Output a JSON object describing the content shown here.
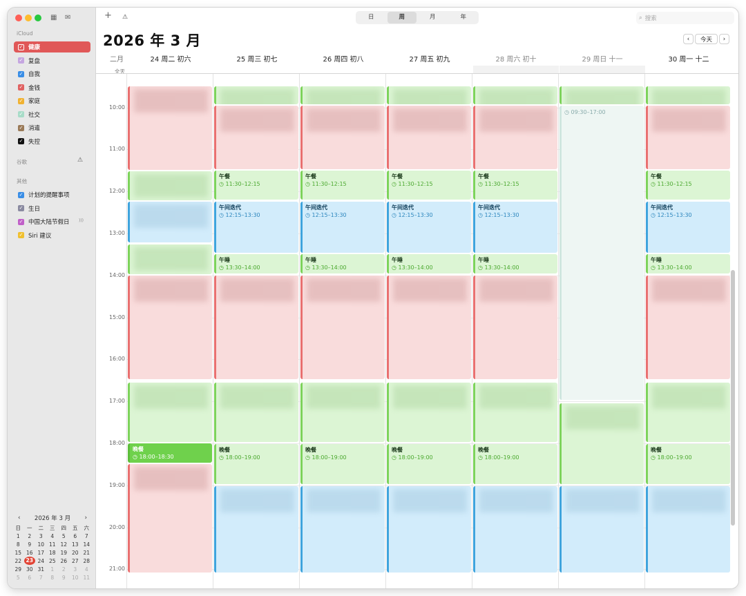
{
  "sidebar": {
    "icloud_label": "iCloud",
    "icloud_items": [
      {
        "label": "健康",
        "color": "#e05858",
        "selected": true
      },
      {
        "label": "复盘",
        "color": "#c5a6e0"
      },
      {
        "label": "自我",
        "color": "#3a8ee6"
      },
      {
        "label": "金钱",
        "color": "#e06262"
      },
      {
        "label": "家庭",
        "color": "#f0b232"
      },
      {
        "label": "社交",
        "color": "#a8dcc8"
      },
      {
        "label": "消遣",
        "color": "#9a7a58"
      },
      {
        "label": "失控",
        "color": "#111111"
      }
    ],
    "google_label": "谷歌",
    "other_label": "其他",
    "other_items": [
      {
        "label": "计划的提醒事项",
        "color": "#3a8ee6"
      },
      {
        "label": "生日",
        "color": "#8a8aa0"
      },
      {
        "label": "中国大陆节假日",
        "color": "#c060c8"
      },
      {
        "label": "Siri 建议",
        "color": "#f0c030"
      }
    ]
  },
  "mini_calendar": {
    "title": "2026 年 3 月",
    "weekdays": [
      "日",
      "一",
      "二",
      "三",
      "四",
      "五",
      "六"
    ],
    "weeks": [
      [
        "1",
        "2",
        "3",
        "4",
        "5",
        "6",
        "7"
      ],
      [
        "8",
        "9",
        "10",
        "11",
        "12",
        "13",
        "14"
      ],
      [
        "15",
        "16",
        "17",
        "18",
        "19",
        "20",
        "21"
      ],
      [
        "22",
        "23",
        "24",
        "25",
        "26",
        "27",
        "28"
      ],
      [
        "29",
        "30",
        "31",
        "1",
        "2",
        "3",
        "4"
      ],
      [
        "5",
        "6",
        "7",
        "8",
        "9",
        "10",
        "11"
      ]
    ],
    "today": "23"
  },
  "toolbar": {
    "add": "+",
    "views": [
      "日",
      "周",
      "月",
      "年"
    ],
    "active_view": "周",
    "search_placeholder": "搜索"
  },
  "header": {
    "title": "2026 年 3 月",
    "today_button": "今天",
    "month_label": "二月",
    "all_day_label": "全天",
    "days": [
      "24 周二  初六",
      "25 周三 初七",
      "26 周四  初八",
      "27 周五  初九",
      "28 周六  初十",
      "29 周日  十一",
      "30 周一  十二"
    ]
  },
  "time_labels": [
    "10:00",
    "11:00",
    "12:00",
    "13:00",
    "14:00",
    "15:00",
    "16:00",
    "17:00",
    "18:00",
    "19:00",
    "20:00",
    "21:00"
  ],
  "events": [
    {
      "col": 0,
      "start": 9.5,
      "end": 11.52,
      "kind": "r"
    },
    {
      "col": 0,
      "start": 11.52,
      "end": 12.25,
      "kind": "g"
    },
    {
      "col": 0,
      "start": 12.25,
      "end": 13.25,
      "kind": "b"
    },
    {
      "col": 0,
      "start": 13.27,
      "end": 14.0,
      "kind": "g"
    },
    {
      "col": 0,
      "start": 14.0,
      "end": 16.5,
      "kind": "r"
    },
    {
      "col": 0,
      "start": 16.55,
      "end": 18.0,
      "kind": "g"
    },
    {
      "col": 0,
      "start": 18.0,
      "end": 18.5,
      "kind": "gs",
      "title": "晚餐",
      "time": "18:00–18:30"
    },
    {
      "col": 0,
      "start": 18.5,
      "end": 21.1,
      "kind": "r"
    },
    {
      "col": 1,
      "start": 9.5,
      "end": 9.95,
      "kind": "g"
    },
    {
      "col": 1,
      "start": 9.95,
      "end": 11.5,
      "kind": "r"
    },
    {
      "col": 1,
      "start": 11.5,
      "end": 12.22,
      "kind": "g",
      "title": "午餐",
      "time": "11:30–12:15"
    },
    {
      "col": 1,
      "start": 12.25,
      "end": 13.5,
      "kind": "b",
      "title": "午间迭代",
      "time": "12:15–13:30"
    },
    {
      "col": 1,
      "start": 13.5,
      "end": 13.98,
      "kind": "g",
      "title": "午睡",
      "time": "13:30–14:00"
    },
    {
      "col": 1,
      "start": 14.0,
      "end": 16.5,
      "kind": "r"
    },
    {
      "col": 1,
      "start": 16.55,
      "end": 18.0,
      "kind": "g"
    },
    {
      "col": 1,
      "start": 18.02,
      "end": 19.0,
      "kind": "g",
      "title": "晚餐",
      "time": "18:00–19:00"
    },
    {
      "col": 1,
      "start": 19.02,
      "end": 21.1,
      "kind": "b"
    },
    {
      "col": 2,
      "start": 9.5,
      "end": 9.95,
      "kind": "g"
    },
    {
      "col": 2,
      "start": 9.95,
      "end": 11.5,
      "kind": "r"
    },
    {
      "col": 2,
      "start": 11.5,
      "end": 12.22,
      "kind": "g",
      "title": "午餐",
      "time": "11:30–12:15"
    },
    {
      "col": 2,
      "start": 12.25,
      "end": 13.5,
      "kind": "b",
      "title": "午间迭代",
      "time": "12:15–13:30"
    },
    {
      "col": 2,
      "start": 13.5,
      "end": 13.98,
      "kind": "g",
      "title": "午睡",
      "time": "13:30–14:00"
    },
    {
      "col": 2,
      "start": 14.0,
      "end": 16.5,
      "kind": "r"
    },
    {
      "col": 2,
      "start": 16.55,
      "end": 18.0,
      "kind": "g"
    },
    {
      "col": 2,
      "start": 18.02,
      "end": 19.0,
      "kind": "g",
      "title": "晚餐",
      "time": "18:00–19:00"
    },
    {
      "col": 2,
      "start": 19.02,
      "end": 21.1,
      "kind": "b"
    },
    {
      "col": 3,
      "start": 9.5,
      "end": 9.95,
      "kind": "g"
    },
    {
      "col": 3,
      "start": 9.95,
      "end": 11.5,
      "kind": "r"
    },
    {
      "col": 3,
      "start": 11.5,
      "end": 12.22,
      "kind": "g",
      "title": "午餐",
      "time": "11:30–12:15"
    },
    {
      "col": 3,
      "start": 12.25,
      "end": 13.5,
      "kind": "b",
      "title": "午间迭代",
      "time": "12:15–13:30"
    },
    {
      "col": 3,
      "start": 13.5,
      "end": 13.98,
      "kind": "g",
      "title": "午睡",
      "time": "13:30–14:00"
    },
    {
      "col": 3,
      "start": 14.0,
      "end": 16.5,
      "kind": "r"
    },
    {
      "col": 3,
      "start": 16.55,
      "end": 18.0,
      "kind": "g"
    },
    {
      "col": 3,
      "start": 18.02,
      "end": 19.0,
      "kind": "g",
      "title": "晚餐",
      "time": "18:00–19:00"
    },
    {
      "col": 3,
      "start": 19.02,
      "end": 21.1,
      "kind": "b"
    },
    {
      "col": 4,
      "start": 9.5,
      "end": 9.95,
      "kind": "g"
    },
    {
      "col": 4,
      "start": 9.95,
      "end": 11.5,
      "kind": "r"
    },
    {
      "col": 4,
      "start": 11.5,
      "end": 12.22,
      "kind": "g",
      "title": "午餐",
      "time": "11:30–12:15"
    },
    {
      "col": 4,
      "start": 12.25,
      "end": 13.5,
      "kind": "b",
      "title": "午间迭代",
      "time": "12:15–13:30"
    },
    {
      "col": 4,
      "start": 13.5,
      "end": 13.98,
      "kind": "g",
      "title": "午睡",
      "time": "13:30–14:00"
    },
    {
      "col": 4,
      "start": 14.0,
      "end": 16.5,
      "kind": "r"
    },
    {
      "col": 4,
      "start": 16.55,
      "end": 18.0,
      "kind": "g"
    },
    {
      "col": 4,
      "start": 18.02,
      "end": 19.0,
      "kind": "g",
      "title": "晚餐",
      "time": "18:00–19:00"
    },
    {
      "col": 4,
      "start": 19.02,
      "end": 21.1,
      "kind": "b"
    },
    {
      "col": 5,
      "start": 9.5,
      "end": 9.95,
      "kind": "g"
    },
    {
      "col": 5,
      "start": 9.95,
      "end": 17.0,
      "kind": "w",
      "time": "09:30–17:00"
    },
    {
      "col": 5,
      "start": 17.05,
      "end": 19.0,
      "kind": "g"
    },
    {
      "col": 5,
      "start": 19.02,
      "end": 21.1,
      "kind": "b"
    },
    {
      "col": 6,
      "start": 9.5,
      "end": 9.95,
      "kind": "g"
    },
    {
      "col": 6,
      "start": 9.95,
      "end": 11.5,
      "kind": "r"
    },
    {
      "col": 6,
      "start": 11.5,
      "end": 12.22,
      "kind": "g",
      "title": "午餐",
      "time": "11:30–12:15"
    },
    {
      "col": 6,
      "start": 12.25,
      "end": 13.5,
      "kind": "b",
      "title": "午间迭代",
      "time": "12:15–13:30"
    },
    {
      "col": 6,
      "start": 13.5,
      "end": 13.98,
      "kind": "g",
      "title": "午睡",
      "time": "13:30–14:00"
    },
    {
      "col": 6,
      "start": 14.0,
      "end": 16.5,
      "kind": "r"
    },
    {
      "col": 6,
      "start": 16.55,
      "end": 18.0,
      "kind": "g"
    },
    {
      "col": 6,
      "start": 18.02,
      "end": 19.0,
      "kind": "g",
      "title": "晚餐",
      "time": "18:00–19:00"
    },
    {
      "col": 6,
      "start": 19.02,
      "end": 21.1,
      "kind": "b"
    }
  ]
}
